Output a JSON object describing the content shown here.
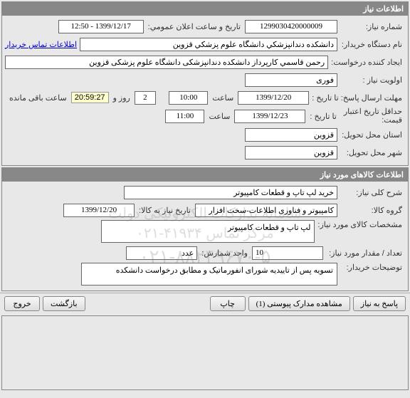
{
  "panel1": {
    "title": "اطلاعات نیاز",
    "need_no_label": "شماره نیاز:",
    "need_no": "1299030420000009",
    "announce_date_label": "تاریخ و ساعت اعلان عمومي:",
    "announce_date": "1399/12/17 - 12:50",
    "buyer_name_label": "نام دستگاه خریدار:",
    "buyer_name": "دانشكده دندانپزشكي دانشگاه علوم پزشكي قزوين",
    "contact_link": "اطلاعات تماس خریدار",
    "creator_label": "ایجاد کننده درخواست:",
    "creator": "رحمن قاسمي كارپرداز دانشکده دندانپزشکی دانشگاه علوم پزشکی قزوین",
    "priority_label": "اولویت نیاز :",
    "priority": "فوری",
    "deadline_send_label": "مهلت ارسال پاسخ:  تا تاریخ :",
    "deadline_send_date": "1399/12/20",
    "time_label": "ساعت",
    "deadline_send_time": "10:00",
    "days_label": "روز و",
    "days": "2",
    "remaining": "20:59:27",
    "remaining_label": "ساعت باقی مانده",
    "min_valid_label": "حداقل تاریخ اعتبار\nقیمت:",
    "min_valid_to_label": "تا تاریخ :",
    "min_valid_date": "1399/12/23",
    "min_valid_time": "11:00",
    "delivery_province_label": "استان محل تحویل:",
    "delivery_province": "قزوين",
    "delivery_city_label": "شهر محل تحویل:",
    "delivery_city": "قزوين"
  },
  "panel2": {
    "title": "اطلاعات کالاهای مورد نیاز",
    "desc_label": "شرح کلی نیاز:",
    "desc": "خرید لپ تاپ و قطعات کامپیوتر",
    "group_label": "گروه کالا:",
    "group": "کامپیوتر و فناوری اطلاعات-سخت افزار",
    "need_date_label": "تاریخ نیاز به کالا:",
    "need_date": "1399/12/20",
    "spec_label": "مشخصات کالای مورد نیاز:",
    "spec": "لپ تاپ و قطعات کامپیوتر",
    "qty_label": "تعداد / مقدار مورد نیاز:",
    "qty": "10",
    "unit_label": "واحد شمارش:",
    "unit": "عدد",
    "buyer_note_label": "توضیحات خریدار:",
    "buyer_note": "تسویه پس از تاییدیه شورای انفورماتیک و مطابق درخواست دانشکده",
    "watermark_line1": "سامانه تدارکات الکترونیکی دولت",
    "watermark_line2": "مرکز تماس ۴۱۹۳۴-۰۲۱",
    "watermark_tel": "۰۲۱-۸۸۲۴۹۶۷۰-۵"
  },
  "buttons": {
    "respond": "پاسخ به نیاز",
    "attachments": "مشاهده مدارک پیوستی (1)",
    "print": "چاپ",
    "back": "بازگشت",
    "exit": "خروج"
  }
}
